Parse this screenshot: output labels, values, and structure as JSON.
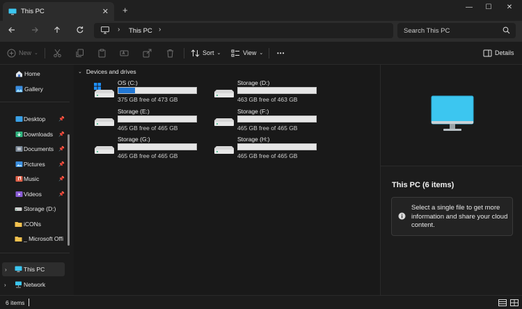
{
  "window": {
    "tab_title": "This PC",
    "tab_close": "✕",
    "new_tab": "+",
    "minimize": "—",
    "maximize": "☐",
    "close": "✕"
  },
  "address_bar": {
    "separator": "›",
    "crumb": "This PC",
    "search_placeholder": "Search This PC"
  },
  "toolbar": {
    "new_label": "New",
    "sort_label": "Sort",
    "view_label": "View",
    "more_label": "•••",
    "details_label": "Details"
  },
  "sidebar": {
    "items": [
      {
        "label": "Home",
        "icon": "home-icon"
      },
      {
        "label": "Gallery",
        "icon": "gallery-icon"
      },
      {
        "label": "Desktop",
        "icon": "desktop-folder-icon",
        "pinned": true
      },
      {
        "label": "Downloads",
        "icon": "downloads-folder-icon",
        "pinned": true
      },
      {
        "label": "Documents",
        "icon": "documents-folder-icon",
        "pinned": true
      },
      {
        "label": "Pictures",
        "icon": "pictures-folder-icon",
        "pinned": true
      },
      {
        "label": "Music",
        "icon": "music-folder-icon",
        "pinned": true
      },
      {
        "label": "Videos",
        "icon": "videos-folder-icon",
        "pinned": true
      },
      {
        "label": "Storage (D:)",
        "icon": "drive-icon"
      },
      {
        "label": "iCONs",
        "icon": "folder-icon"
      },
      {
        "label": "_ Microsoft Offi",
        "icon": "folder-icon"
      },
      {
        "label": "This PC",
        "icon": "this-pc-icon",
        "selected": true
      },
      {
        "label": "Network",
        "icon": "network-icon"
      }
    ]
  },
  "content": {
    "group_title": "Devices and drives",
    "drives": [
      {
        "name": "OS (C:)",
        "free_text": "375 GB free of 473 GB",
        "used_fraction": 0.21,
        "is_os": true
      },
      {
        "name": "Storage (D:)",
        "free_text": "463 GB free of 463 GB",
        "used_fraction": 0.0
      },
      {
        "name": "Storage (E:)",
        "free_text": "465 GB free of 465 GB",
        "used_fraction": 0.0
      },
      {
        "name": "Storage (F:)",
        "free_text": "465 GB free of 465 GB",
        "used_fraction": 0.0
      },
      {
        "name": "Storage (G:)",
        "free_text": "465 GB free of 465 GB",
        "used_fraction": 0.0
      },
      {
        "name": "Storage (H:)",
        "free_text": "465 GB free of 465 GB",
        "used_fraction": 0.0
      }
    ]
  },
  "details_pane": {
    "title": "This PC (6 items)",
    "message": "Select a single file to get more information and share your cloud content."
  },
  "status_bar": {
    "item_count": "6 items"
  },
  "colors": {
    "accent": "#2177d4",
    "monitor": "#3cc6f0"
  }
}
